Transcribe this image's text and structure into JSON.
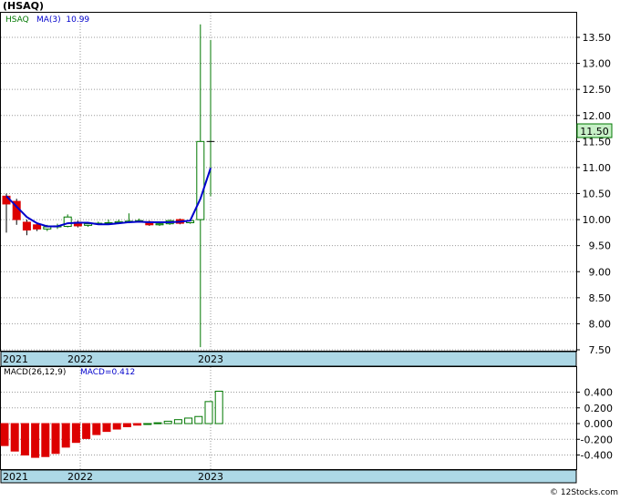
{
  "header": {
    "ticker_title": "(HSAQ)"
  },
  "price_panel": {
    "legend_symbol": "HSAQ",
    "legend_ma": "MA(3)  10.99",
    "last_price_tag": "11.50",
    "y_ticks": [
      "13.50",
      "13.00",
      "12.50",
      "12.00",
      "11.50",
      "11.00",
      "10.50",
      "10.00",
      "9.50",
      "9.00",
      "8.50",
      "8.00",
      "7.50"
    ]
  },
  "time_axis": {
    "labels": [
      "2021",
      "2022",
      "2023"
    ]
  },
  "macd_panel": {
    "legend_params": "MACD(26,12,9)",
    "legend_value": "MACD=0.412",
    "y_ticks": [
      "0.400",
      "0.200",
      "0.000",
      "-0.200",
      "-0.400"
    ]
  },
  "footer": {
    "credit": "© 12Stocks.com"
  },
  "colors": {
    "up": "#007700",
    "down": "#dd0000",
    "ma_line": "#0000cc",
    "axis_band": "#add8e6",
    "price_tag_bg": "#c8f0c8",
    "grid": "#999999"
  },
  "chart_data": [
    {
      "type": "candlestick",
      "title": "(HSAQ)",
      "series_name": "HSAQ",
      "ylim": [
        7.5,
        13.5
      ],
      "y_ticks": [
        13.5,
        13.0,
        12.5,
        12.0,
        11.5,
        11.0,
        10.5,
        10.0,
        9.5,
        9.0,
        8.5,
        8.0,
        7.5
      ],
      "x_labels": [
        "2021",
        "2022",
        "2023"
      ],
      "candles": [
        {
          "o": 10.45,
          "h": 10.5,
          "c": 10.3,
          "l": 9.75
        },
        {
          "o": 10.35,
          "h": 10.4,
          "c": 10.0,
          "l": 9.9
        },
        {
          "o": 9.95,
          "h": 10.0,
          "c": 9.8,
          "l": 9.7
        },
        {
          "o": 9.9,
          "h": 9.95,
          "c": 9.82,
          "l": 9.78
        },
        {
          "o": 9.82,
          "h": 9.9,
          "c": 9.86,
          "l": 9.78
        },
        {
          "o": 9.86,
          "h": 9.92,
          "c": 9.88,
          "l": 9.82
        },
        {
          "o": 9.87,
          "h": 10.1,
          "c": 10.05,
          "l": 9.85
        },
        {
          "o": 9.95,
          "h": 9.98,
          "c": 9.88,
          "l": 9.85
        },
        {
          "o": 9.89,
          "h": 9.95,
          "c": 9.92,
          "l": 9.86
        },
        {
          "o": 9.92,
          "h": 9.96,
          "c": 9.93,
          "l": 9.9
        },
        {
          "o": 9.93,
          "h": 10.0,
          "c": 9.94,
          "l": 9.91
        },
        {
          "o": 9.94,
          "h": 10.0,
          "c": 9.96,
          "l": 9.92
        },
        {
          "o": 9.96,
          "h": 10.12,
          "c": 9.97,
          "l": 9.93
        },
        {
          "o": 9.97,
          "h": 10.02,
          "c": 9.98,
          "l": 9.94
        },
        {
          "o": 9.96,
          "h": 9.98,
          "c": 9.9,
          "l": 9.88
        },
        {
          "o": 9.9,
          "h": 9.93,
          "c": 9.92,
          "l": 9.88
        },
        {
          "o": 9.92,
          "h": 10.0,
          "c": 9.98,
          "l": 9.9
        },
        {
          "o": 10.0,
          "h": 10.02,
          "c": 9.93,
          "l": 9.91
        },
        {
          "o": 9.94,
          "h": 10.0,
          "c": 9.98,
          "l": 9.92
        },
        {
          "o": 10.0,
          "h": 13.75,
          "c": 11.5,
          "l": 7.55
        },
        {
          "o": 11.5,
          "h": 13.45,
          "c": 11.5,
          "l": 10.45
        }
      ],
      "ma3": [
        10.45,
        10.25,
        10.05,
        9.93,
        9.87,
        9.87,
        9.93,
        9.94,
        9.94,
        9.91,
        9.91,
        9.93,
        9.95,
        9.96,
        9.95,
        9.95,
        9.95,
        9.96,
        9.98,
        10.4,
        10.99
      ]
    },
    {
      "type": "bar",
      "title": "MACD(26,12,9)",
      "series_name": "MACD",
      "ylim": [
        -0.45,
        0.45
      ],
      "y_ticks": [
        0.4,
        0.2,
        0.0,
        -0.2,
        -0.4
      ],
      "x_labels": [
        "2021",
        "2022",
        "2023"
      ],
      "values": [
        -0.28,
        -0.35,
        -0.4,
        -0.43,
        -0.42,
        -0.38,
        -0.3,
        -0.24,
        -0.19,
        -0.14,
        -0.1,
        -0.07,
        -0.04,
        -0.02,
        0.0,
        0.01,
        0.03,
        0.05,
        0.07,
        0.09,
        0.28,
        0.412
      ]
    }
  ]
}
